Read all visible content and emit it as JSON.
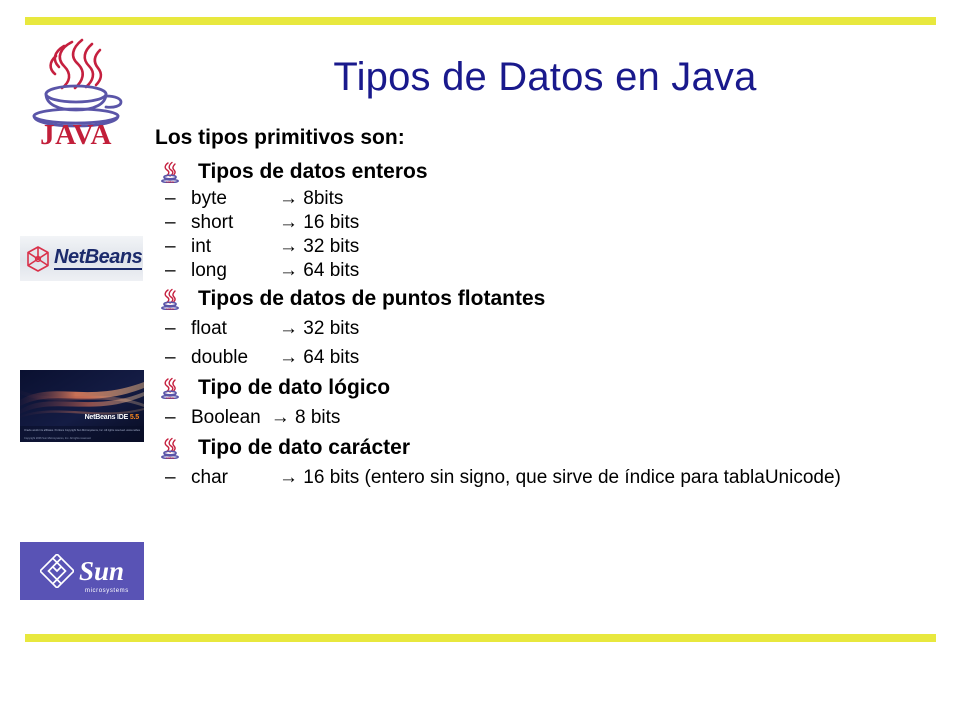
{
  "slide": {
    "title": "Tipos de Datos en Java",
    "lead": "Los tipos primitivos son:",
    "title_color": "#19198c",
    "rule_color": "#e8e83e"
  },
  "logos": [
    {
      "name": "java-logo",
      "wordmark": "JAVA",
      "alt": "Java coffee cup logo"
    },
    {
      "name": "netbeans-logo",
      "wordmark": "NetBeans",
      "alt": "NetBeans logo"
    },
    {
      "name": "netbeans-ide-splash",
      "product": "NetBeans",
      "edition": "IDE",
      "version": "5.5",
      "legal": "Oracle and/or its affiliates. Portions Copyright Sun Microsystems, Inc. All rights reserved. www.netbeans.org",
      "legal2": "Copyright 2006 Sun Microsystems, Inc. All rights reserved."
    },
    {
      "name": "sun-microsystems-logo",
      "wordmark": "Sun",
      "subtitle": "microsystems"
    }
  ],
  "sections": [
    {
      "heading": "Tipos de datos enteros",
      "spacing": "tight",
      "items": [
        {
          "dash": "–",
          "name": "byte",
          "arrow": "→",
          "value": "8bits",
          "aligned": true
        },
        {
          "dash": "–",
          "name": "short",
          "arrow": "→",
          "value": "16 bits",
          "aligned": true
        },
        {
          "dash": "–",
          "name": "int",
          "arrow": "→",
          "value": "32 bits",
          "aligned": true
        },
        {
          "dash": "–",
          "name": "long",
          "arrow": "→",
          "value": "64 bits",
          "aligned": true
        }
      ]
    },
    {
      "heading": "Tipos de datos de puntos flotantes",
      "spacing": "loose",
      "items": [
        {
          "dash": "–",
          "name": "float",
          "arrow": "→",
          "value": "32 bits",
          "aligned": true
        },
        {
          "dash": "–",
          "name": "double",
          "arrow": "→",
          "value": "64 bits",
          "aligned": true
        }
      ]
    },
    {
      "heading": "Tipo de dato lógico",
      "spacing": "loose",
      "items": [
        {
          "dash": "–",
          "name": "Boolean",
          "arrow": "→",
          "value": "8 bits",
          "aligned": false
        }
      ]
    },
    {
      "heading": "Tipo de dato carácter",
      "spacing": "loose",
      "items": [
        {
          "dash": "–",
          "name": "char",
          "arrow": "→",
          "value": "16 bits (entero sin signo, que sirve de índice para tablaUnicode)",
          "aligned": true,
          "wraps": true
        }
      ]
    }
  ]
}
